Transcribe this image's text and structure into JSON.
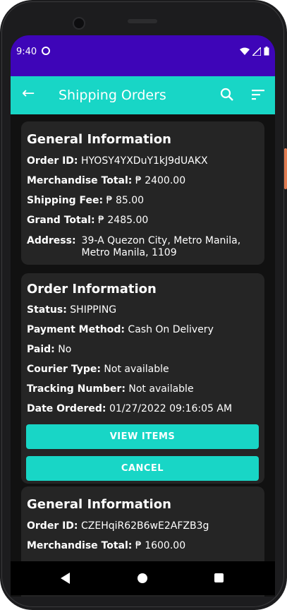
{
  "status_bar": {
    "time": "9:40"
  },
  "app_bar": {
    "title": "Shipping Orders"
  },
  "orders": [
    {
      "general_heading": "General Information",
      "order_id_label": "Order ID:",
      "order_id": "HYOSY4YXDuY1kJ9dUAKX",
      "merch_label": "Merchandise Total:",
      "merch_total": "₱ 2400.00",
      "fee_label": "Shipping Fee:",
      "shipping_fee": "₱ 85.00",
      "grand_label": "Grand Total:",
      "grand_total": "₱ 2485.00",
      "address_label": "Address:",
      "address_line1": "39-A Quezon City, Metro Manila,",
      "address_line2": "Metro Manila, 1109",
      "order_heading": "Order Information",
      "status_label": "Status:",
      "status": "SHIPPING",
      "payment_label": "Payment Method:",
      "payment_method": "Cash On Delivery",
      "paid_label": "Paid:",
      "paid": "No",
      "courier_label": "Courier Type:",
      "courier_type": "Not available",
      "tracking_label": "Tracking Number:",
      "tracking_number": "Not available",
      "date_label": "Date Ordered:",
      "date_ordered": "01/27/2022 09:16:05 AM",
      "view_items_label": "VIEW ITEMS",
      "cancel_label": "CANCEL"
    },
    {
      "general_heading": "General Information",
      "order_id_label": "Order ID:",
      "order_id": "CZEHqiR62B6wE2AFZB3g",
      "merch_label": "Merchandise Total:",
      "merch_total": "₱ 1600.00"
    }
  ],
  "colors": {
    "status_bar": "#3e05b8",
    "app_bar": "#18d6c6",
    "card": "#252525",
    "background": "#111111"
  }
}
